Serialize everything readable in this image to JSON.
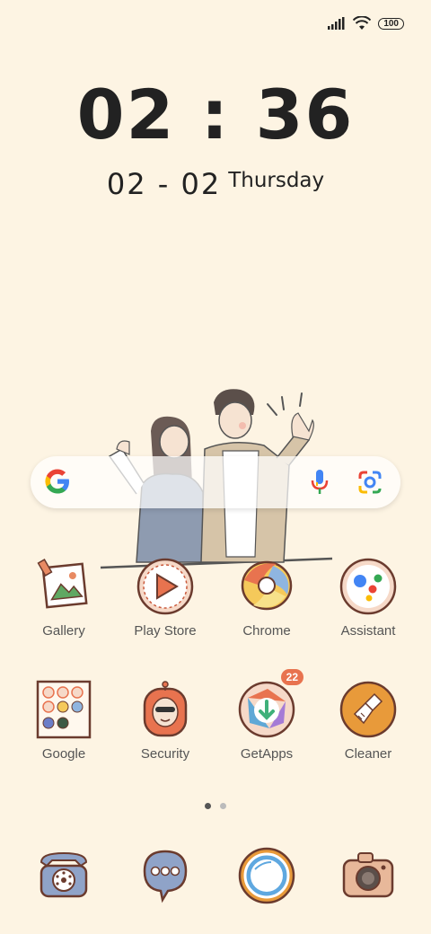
{
  "status": {
    "battery": "100"
  },
  "lockclock": {
    "time": "02 : 36",
    "date": "02 - 02",
    "day": "Thursday"
  },
  "apps_row1": [
    {
      "label": "Gallery",
      "icon": "gallery-icon"
    },
    {
      "label": "Play Store",
      "icon": "play-store-icon"
    },
    {
      "label": "Chrome",
      "icon": "chrome-icon"
    },
    {
      "label": "Assistant",
      "icon": "assistant-icon"
    }
  ],
  "apps_row2": [
    {
      "label": "Google",
      "icon": "google-folder-icon"
    },
    {
      "label": "Security",
      "icon": "security-icon"
    },
    {
      "label": "GetApps",
      "icon": "getapps-icon",
      "badge": "22"
    },
    {
      "label": "Cleaner",
      "icon": "cleaner-icon"
    }
  ],
  "dock": [
    {
      "icon": "phone-icon"
    },
    {
      "icon": "messages-icon"
    },
    {
      "icon": "browser-icon"
    },
    {
      "icon": "camera-icon"
    }
  ],
  "pages": {
    "count": 2,
    "active": 1
  }
}
